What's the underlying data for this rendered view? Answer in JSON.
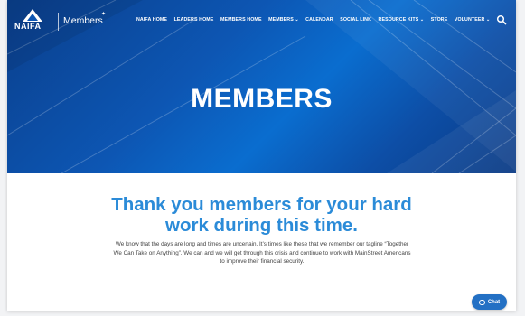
{
  "header": {
    "logo_text": "NAIFA",
    "brand": "Members",
    "nav": [
      {
        "label": "NAIFA HOME",
        "dropdown": false
      },
      {
        "label": "LEADERS HOME",
        "dropdown": false
      },
      {
        "label": "MEMBERS HOME",
        "dropdown": false
      },
      {
        "label": "MEMBERS",
        "dropdown": true
      },
      {
        "label": "CALENDAR",
        "dropdown": false
      },
      {
        "label": "SOCIAL LINK",
        "dropdown": false
      },
      {
        "label": "RESOURCE KITS",
        "dropdown": true
      },
      {
        "label": "STORE",
        "dropdown": false
      },
      {
        "label": "VOLUNTEER",
        "dropdown": true
      }
    ]
  },
  "hero": {
    "title": "MEMBERS"
  },
  "content": {
    "title_line1": "Thank you members for your hard",
    "title_line2": "work during this time.",
    "body": "We know that the days are long and times are uncertain. It’s times like these that we remember our tagline “Together We Can Take on Anything”. We can and we will get through this crisis and continue to work with MainStreet Americans to improve their financial security."
  },
  "chat": {
    "label": "Chat"
  },
  "colors": {
    "hero_blue": "#0d56b3",
    "title_blue": "#2b8bd8",
    "chat_blue": "#2370c4"
  }
}
